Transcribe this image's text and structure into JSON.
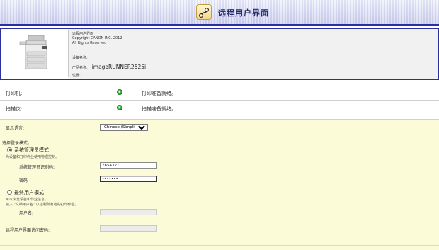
{
  "header": {
    "title": "远程用户界面"
  },
  "device": {
    "lines": [
      "远程用户界面",
      "Copyright CANON INC. 2012",
      "All Rights Reserved"
    ],
    "name_label": "设备名称:",
    "product_label": "产品名称:",
    "product_value": "imageRUNNER2525i",
    "location_label": "位置:"
  },
  "status": {
    "printer_label": "打印机:",
    "printer_status": "打印准备就绪。",
    "scanner_label": "扫描仪:",
    "scanner_status": "扫描准备就绪。",
    "indicator_color": "#1fa02a"
  },
  "form": {
    "language_label": "显示语言:",
    "language_value": "Chinese (Simplified)",
    "login_prompt": "选择登录模式。",
    "admin_mode_label": "系统管理员模式",
    "admin_mode_desc": "为设备和打印作业使用管理控制。",
    "admin_id_label": "系统管理员识别码:",
    "admin_id_value": "7654321",
    "password_label": "密码",
    "password_value": "•••••••",
    "user_mode_label": "最终用户模式",
    "user_mode_desc1": "可以浏览设备和作业信息。",
    "user_mode_desc2": "输入 \"文档用户名\" 以控制所有者的打印作业。",
    "username_label": "用户名:",
    "rui_password_label": "远程用户界面访问密码:"
  }
}
